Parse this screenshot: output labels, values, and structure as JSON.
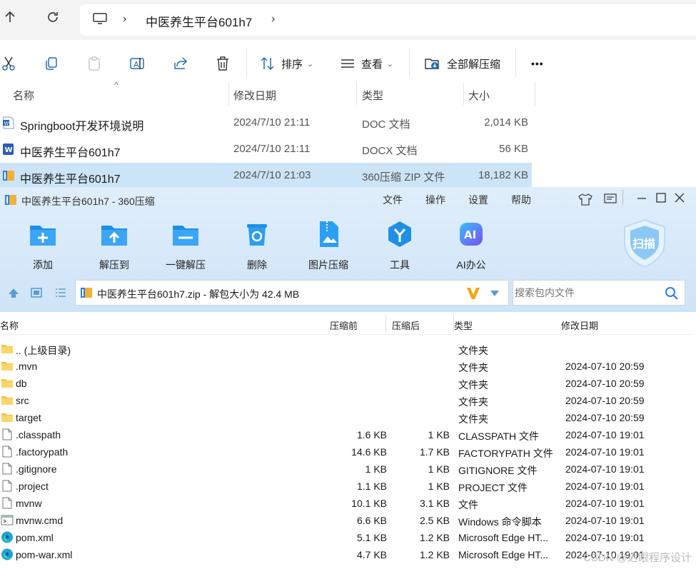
{
  "explorer": {
    "breadcrumb": "中医养生平台601h7",
    "toolbar": {
      "sort_label": "排序",
      "view_label": "查看",
      "extract_all_label": "全部解压缩",
      "more_label": "•••"
    },
    "columns": {
      "name": "名称",
      "date": "修改日期",
      "type": "类型",
      "size": "大小"
    },
    "files": [
      {
        "name": "Springboot开发环境说明",
        "date": "2024/7/10 21:11",
        "type": "DOC 文档",
        "size": "2,014 KB",
        "icon": "word-doc-icon",
        "selected": false
      },
      {
        "name": "中医养生平台601h7",
        "date": "2024/7/10 21:11",
        "type": "DOCX 文档",
        "size": "56 KB",
        "icon": "word-docx-icon",
        "selected": false
      },
      {
        "name": "中医养生平台601h7",
        "date": "2024/7/10 21:03",
        "type": "360压缩 ZIP 文件",
        "size": "18,182 KB",
        "icon": "zip-archive-icon",
        "selected": true
      }
    ]
  },
  "zip": {
    "title": "中医养生平台601h7 - 360压缩",
    "menu": [
      "文件",
      "操作",
      "设置",
      "帮助"
    ],
    "actions": [
      {
        "label": "添加",
        "icon": "add-icon",
        "color": "#1e8fe6"
      },
      {
        "label": "解压到",
        "icon": "extract-to-icon",
        "color": "#1e8fe6"
      },
      {
        "label": "一键解压",
        "icon": "one-click-extract-icon",
        "color": "#1e8fe6"
      },
      {
        "label": "删除",
        "icon": "delete-icon",
        "color": "#1e8fe6"
      },
      {
        "label": "图片压缩",
        "icon": "image-compress-icon",
        "color": "#1e8fe6"
      },
      {
        "label": "工具",
        "icon": "tools-icon",
        "color": "#1e8fe6"
      },
      {
        "label": "AI办公",
        "icon": "ai-office-icon",
        "color": "#2f7cf0"
      }
    ],
    "scan_label": "扫描",
    "address": "中医养生平台601h7.zip - 解包大小为 42.4 MB",
    "search_placeholder": "搜索包内文件",
    "columns": {
      "name": "名称",
      "before": "压缩前",
      "after": "压缩后",
      "type": "类型",
      "date": "修改日期"
    },
    "entries": [
      {
        "name": ".. (上级目录)",
        "before": "",
        "after": "",
        "type": "文件夹",
        "date": "",
        "icon": "folder-icon"
      },
      {
        "name": ".mvn",
        "before": "",
        "after": "",
        "type": "文件夹",
        "date": "2024-07-10 20:59",
        "icon": "folder-icon"
      },
      {
        "name": "db",
        "before": "",
        "after": "",
        "type": "文件夹",
        "date": "2024-07-10 20:59",
        "icon": "folder-icon"
      },
      {
        "name": "src",
        "before": "",
        "after": "",
        "type": "文件夹",
        "date": "2024-07-10 20:59",
        "icon": "folder-icon"
      },
      {
        "name": "target",
        "before": "",
        "after": "",
        "type": "文件夹",
        "date": "2024-07-10 20:59",
        "icon": "folder-icon"
      },
      {
        "name": ".classpath",
        "before": "1.6 KB",
        "after": "1 KB",
        "type": "CLASSPATH 文件",
        "date": "2024-07-10 19:01",
        "icon": "file-icon"
      },
      {
        "name": ".factorypath",
        "before": "14.6 KB",
        "after": "1.7 KB",
        "type": "FACTORYPATH 文件",
        "date": "2024-07-10 19:01",
        "icon": "file-icon"
      },
      {
        "name": ".gitignore",
        "before": "1 KB",
        "after": "1 KB",
        "type": "GITIGNORE 文件",
        "date": "2024-07-10 19:01",
        "icon": "file-icon"
      },
      {
        "name": ".project",
        "before": "1.1 KB",
        "after": "1 KB",
        "type": "PROJECT 文件",
        "date": "2024-07-10 19:01",
        "icon": "file-icon"
      },
      {
        "name": "mvnw",
        "before": "10.1 KB",
        "after": "3.1 KB",
        "type": "文件",
        "date": "2024-07-10 19:01",
        "icon": "file-icon"
      },
      {
        "name": "mvnw.cmd",
        "before": "6.6 KB",
        "after": "2.5 KB",
        "type": "Windows 命令脚本",
        "date": "2024-07-10 19:01",
        "icon": "cmd-script-icon"
      },
      {
        "name": "pom.xml",
        "before": "5.1 KB",
        "after": "1.2 KB",
        "type": "Microsoft Edge HT...",
        "date": "2024-07-10 19:01",
        "icon": "edge-icon"
      },
      {
        "name": "pom-war.xml",
        "before": "4.7 KB",
        "after": "1.2 KB",
        "type": "Microsoft Edge HT...",
        "date": "2024-07-10 19:01",
        "icon": "edge-icon"
      }
    ]
  },
  "watermark": "CSDN @迟眼程序设计"
}
